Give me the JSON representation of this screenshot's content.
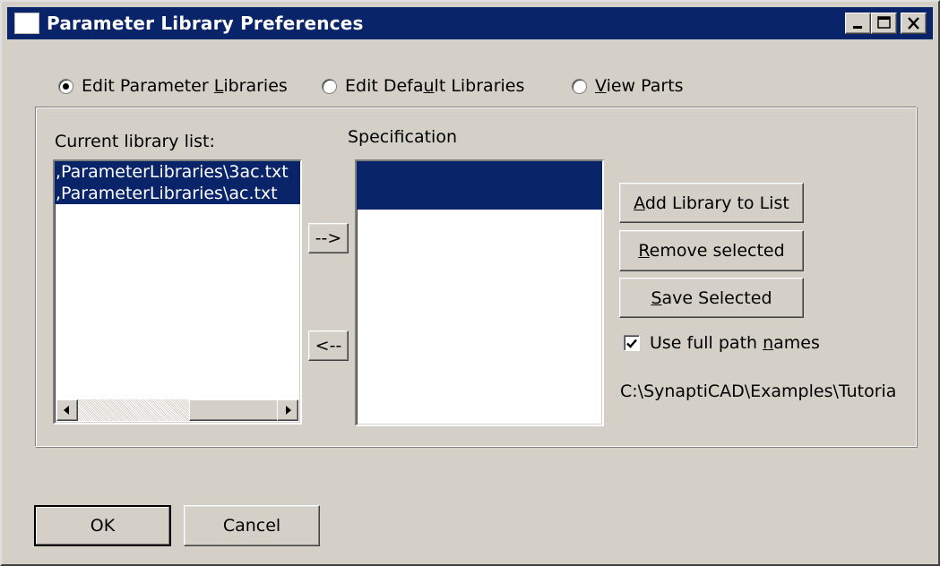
{
  "window": {
    "title": "Parameter Library Preferences",
    "controls": [
      "minimize-icon",
      "maximize-icon",
      "close-icon"
    ]
  },
  "modes": [
    {
      "label_pre": "Edit Parameter ",
      "label_u": "L",
      "label_post": "ibraries",
      "selected": true
    },
    {
      "label_pre": "Edit Defa",
      "label_u": "u",
      "label_post": "lt Libraries",
      "selected": false
    },
    {
      "label_pre": "",
      "label_u": "V",
      "label_post": "iew Parts",
      "selected": false
    }
  ],
  "current_list": {
    "label": "Current library list:",
    "items": [
      ",ParameterLibraries\\3ac.txt",
      ",ParameterLibraries\\ac.txt"
    ],
    "selected": [
      0,
      1
    ]
  },
  "specification": {
    "label": "Specification",
    "items": [
      "",
      ""
    ],
    "selected": [
      0,
      1
    ]
  },
  "transfer": {
    "add_arrow": "-->",
    "remove_arrow": "<--"
  },
  "actions": {
    "add_library": {
      "u": "A",
      "rest": "dd Library to List"
    },
    "remove_selected": {
      "u": "R",
      "rest": "emove selected"
    },
    "save_selected": {
      "u": "S",
      "rest": "ave Selected"
    }
  },
  "full_path": {
    "pre": "Use full path ",
    "u": "n",
    "post": "ames",
    "checked": true
  },
  "path_text": "C:\\SynaptiCAD\\Examples\\Tutoria",
  "footer": {
    "ok": "OK",
    "cancel": "Cancel"
  }
}
